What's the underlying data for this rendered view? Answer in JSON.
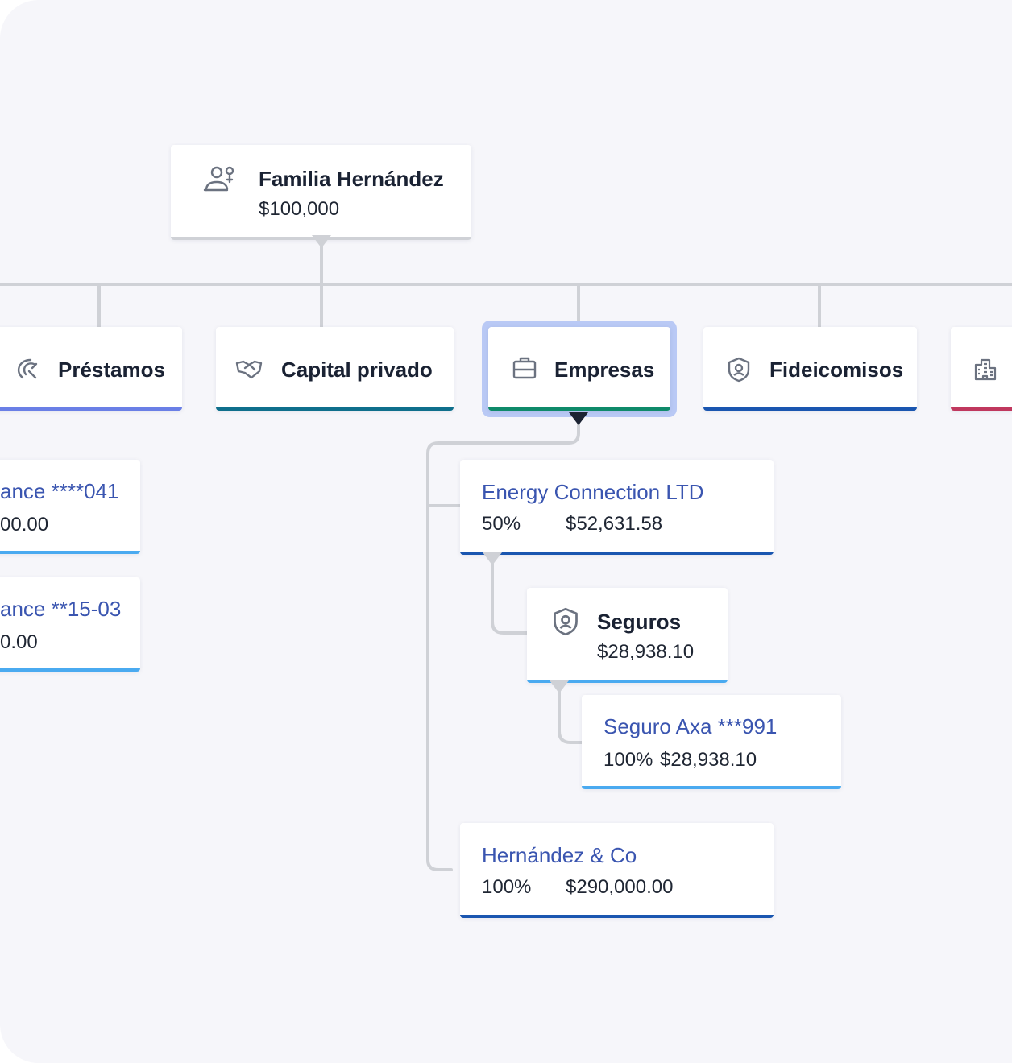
{
  "root": {
    "title": "Familia Hernández",
    "amount": "$100,000",
    "icon": "family-icon"
  },
  "categories": [
    {
      "label": "Préstamos",
      "icon": "loan-icon",
      "color": "#6a7fe6"
    },
    {
      "label": "Capital privado",
      "icon": "handshake-icon",
      "color": "#0f6f8c"
    },
    {
      "label": "Empresas",
      "icon": "briefcase-icon",
      "color": "#0f8a6a",
      "selected": true
    },
    {
      "label": "Fideicomisos",
      "icon": "shield-icon",
      "color": "#1a56b0"
    },
    {
      "label": "",
      "icon": "building-icon",
      "color": "#c0385e"
    }
  ],
  "loans": [
    {
      "name": "ance ****041",
      "amount": "00.00"
    },
    {
      "name": "ance **15-03",
      "amount": "0.00"
    }
  ],
  "companies": [
    {
      "name": "Energy Connection LTD",
      "percent": "50%",
      "amount": "$52,631.58"
    },
    {
      "name": "Hernández & Co",
      "percent": "100%",
      "amount": "$290,000.00"
    }
  ],
  "insurance": {
    "title": "Seguros",
    "amount": "$28,938.10",
    "icon": "shield-icon",
    "policy": {
      "name": "Seguro Axa ***991",
      "percent": "100%",
      "amount": "$28,938.10"
    }
  },
  "colors": {
    "accent": "#3a55b0",
    "light_blue_bar": "#4aaaf0",
    "dark_blue_bar": "#1a56b0",
    "connector": "#cfd1d6"
  }
}
